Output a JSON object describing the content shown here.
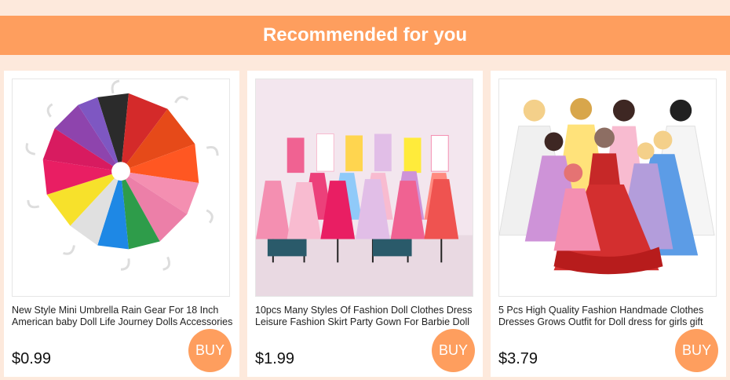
{
  "header": {
    "title": "Recommended for you"
  },
  "products": [
    {
      "title": "New Style Mini Umbrella Rain Gear For 18 Inch American baby Doll Life Journey Dolls Accessories",
      "price": "$0.99",
      "buy_label": "BUY"
    },
    {
      "title": "10pcs Many Styles Of Fashion Doll Clothes Dress Leisure Fashion Skirt Party Gown For Barbie Doll",
      "price": "$1.99",
      "buy_label": "BUY"
    },
    {
      "title": "5 Pcs High Quality Fashion Handmade Clothes Dresses Grows Outfit for Doll dress for girls gift",
      "price": "$3.79",
      "buy_label": "BUY"
    }
  ],
  "colors": {
    "page_background": "#fde9dc",
    "accent": "#fe9e5e",
    "card_background": "#ffffff"
  }
}
